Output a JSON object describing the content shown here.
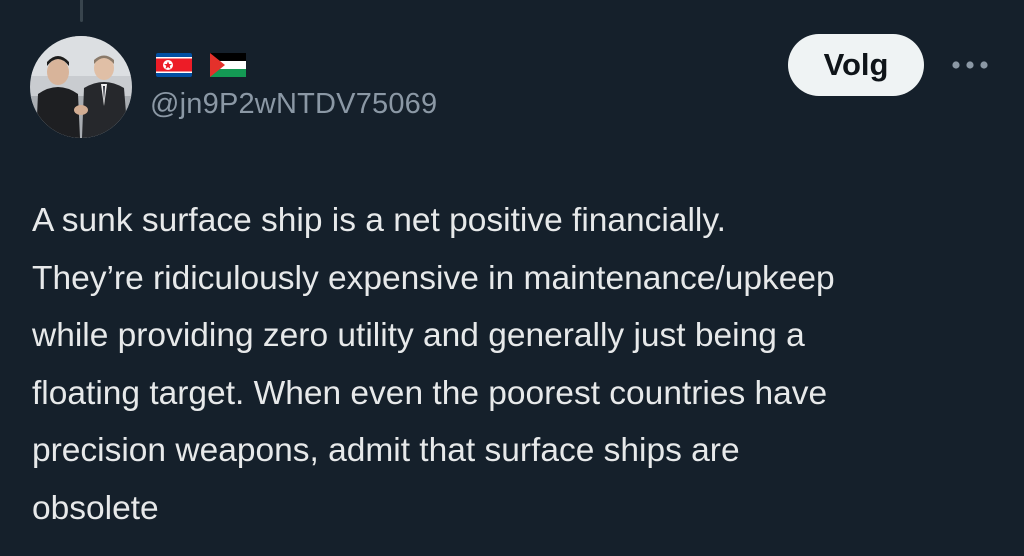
{
  "post": {
    "author": {
      "handle": "@jn9P2wNTDV75069",
      "flags": [
        "north-korea-flag-icon",
        "palestine-flag-icon"
      ]
    },
    "follow_label": "Volg",
    "text": "A sunk surface ship is a net positive financially.\nThey’re ridiculously expensive in maintenance/upkeep\nwhile providing zero utility and generally just being a\nfloating target. When even the poorest countries have\nprecision weapons, admit that surface ships are\nobsolete"
  },
  "colors": {
    "background": "#15202b",
    "text_primary": "#e7e9ea",
    "text_secondary": "#8b98a5",
    "button_bg": "#eff3f4",
    "button_text": "#0f1419"
  },
  "icons": {
    "more": "more-horizontal-icon"
  }
}
